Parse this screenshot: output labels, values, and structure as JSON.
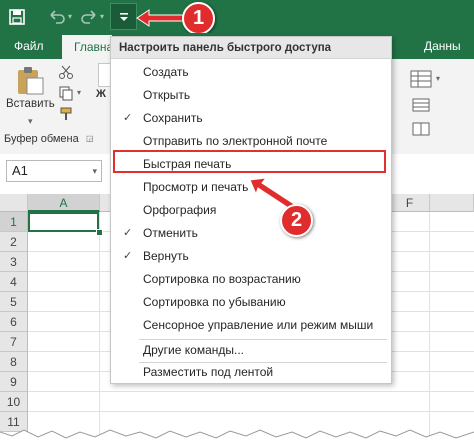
{
  "quick_access": {
    "save_icon": "save-icon",
    "undo_icon": "undo-icon",
    "redo_icon": "redo-icon",
    "customize_icon": "customize-qat-icon"
  },
  "tabs": [
    "Файл",
    "Главна",
    "Данны"
  ],
  "ribbon": {
    "paste_label": "Вставить",
    "clipboard_label": "Буфер обмена"
  },
  "name_box": "A1",
  "columns": [
    "A",
    "F"
  ],
  "rows": [
    "1",
    "2",
    "3",
    "4",
    "5",
    "6",
    "7",
    "8",
    "9",
    "10",
    "11"
  ],
  "menu": {
    "header": "Настроить панель быстрого доступа",
    "items": [
      {
        "label": "Создать",
        "checked": false
      },
      {
        "label": "Открыть",
        "checked": false
      },
      {
        "label": "Сохранить",
        "checked": true
      },
      {
        "label": "Отправить по электронной почте",
        "checked": false
      },
      {
        "label": "Быстрая печать",
        "checked": false
      },
      {
        "label": "Просмотр и печать",
        "checked": false
      },
      {
        "label": "Орфография",
        "checked": false
      },
      {
        "label": "Отменить",
        "checked": true
      },
      {
        "label": "Вернуть",
        "checked": true
      },
      {
        "label": "Сортировка по возрастанию",
        "checked": false
      },
      {
        "label": "Сортировка по убыванию",
        "checked": false
      },
      {
        "label": "Сенсорное управление или режим мыши",
        "checked": false
      },
      {
        "label": "Другие команды...",
        "checked": false
      },
      {
        "label": "Разместить под лентой",
        "checked": false
      }
    ],
    "check_glyph": "✓"
  },
  "badges": [
    "1",
    "2"
  ],
  "colors": {
    "accent": "#217346",
    "callout": "#e02c2c"
  }
}
